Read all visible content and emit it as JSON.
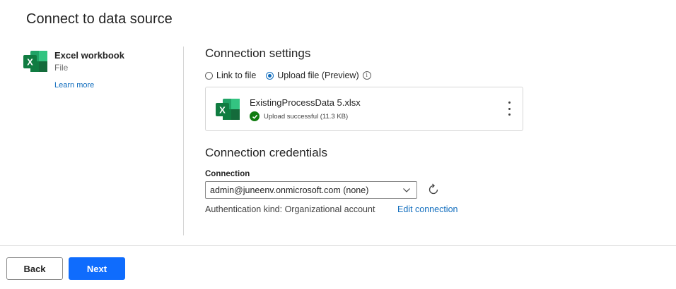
{
  "page": {
    "title": "Connect to data source"
  },
  "source": {
    "name": "Excel workbook",
    "kind": "File",
    "learn_more": "Learn more",
    "icon": "excel-icon",
    "icon_letter": "X"
  },
  "settings": {
    "heading": "Connection settings",
    "options": [
      "Link to file",
      "Upload file (Preview)"
    ],
    "selected_option": "Upload file (Preview)",
    "info_glyph": "i"
  },
  "file": {
    "name": "ExistingProcessData 5.xlsx",
    "status": "Upload successful (11.3 KB)",
    "icon_letter": "X"
  },
  "credentials": {
    "heading": "Connection credentials",
    "connection_label": "Connection",
    "connection_value": "admin@juneenv.onmicrosoft.com (none)",
    "auth_text": "Authentication kind: Organizational account",
    "edit_link": "Edit connection"
  },
  "footer": {
    "back_label": "Back",
    "next_label": "Next"
  },
  "colors": {
    "accent": "#0f6cbd",
    "primary_button": "#0f6cfd",
    "excel_green": "#107c41",
    "success": "#107c10"
  }
}
